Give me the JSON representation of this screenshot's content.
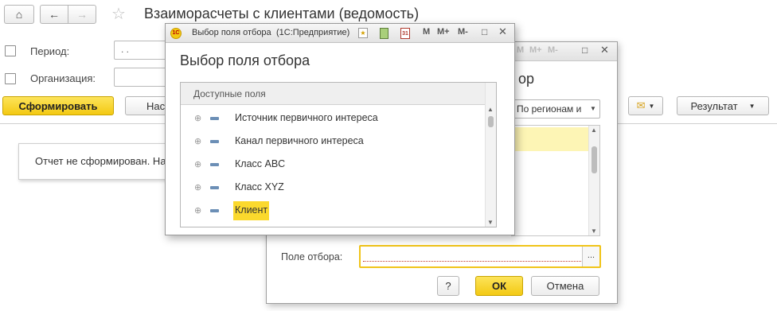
{
  "main": {
    "title": "Взаиморасчеты с клиентами (ведомость)",
    "period_label": "Период:",
    "period_value": ". .",
    "org_label": "Организация:",
    "generate_button": "Сформировать",
    "settings_button": "Нас",
    "result_button": "Результат",
    "message": "Отчет не сформирован. Наж"
  },
  "back_dialog": {
    "title_fragment": "ор",
    "dropdown_value": "По регионам и",
    "filter_label": "Поле отбора:",
    "filter_value": "",
    "browse_label": "...",
    "help_label": "?",
    "ok_label": "ОК",
    "cancel_label": "Отмена"
  },
  "front_dialog": {
    "window_title": "Выбор поля отбора",
    "app_name": "(1С:Предприятие)",
    "heading": "Выбор поля отбора",
    "tree_header": "Доступные поля",
    "items": [
      {
        "label": "Источник первичного интереса",
        "selected": false
      },
      {
        "label": "Канал первичного интереса",
        "selected": false
      },
      {
        "label": "Класс ABC",
        "selected": false
      },
      {
        "label": "Класс XYZ",
        "selected": false
      },
      {
        "label": "Клиент",
        "selected": true
      }
    ],
    "toolbar": {
      "m": "M",
      "m_plus": "M+",
      "m_minus": "M-"
    }
  },
  "colors": {
    "accent_yellow": "#fbd92d",
    "button_yellow": "#f3c913",
    "selection_highlight": "#fdf5b5"
  }
}
